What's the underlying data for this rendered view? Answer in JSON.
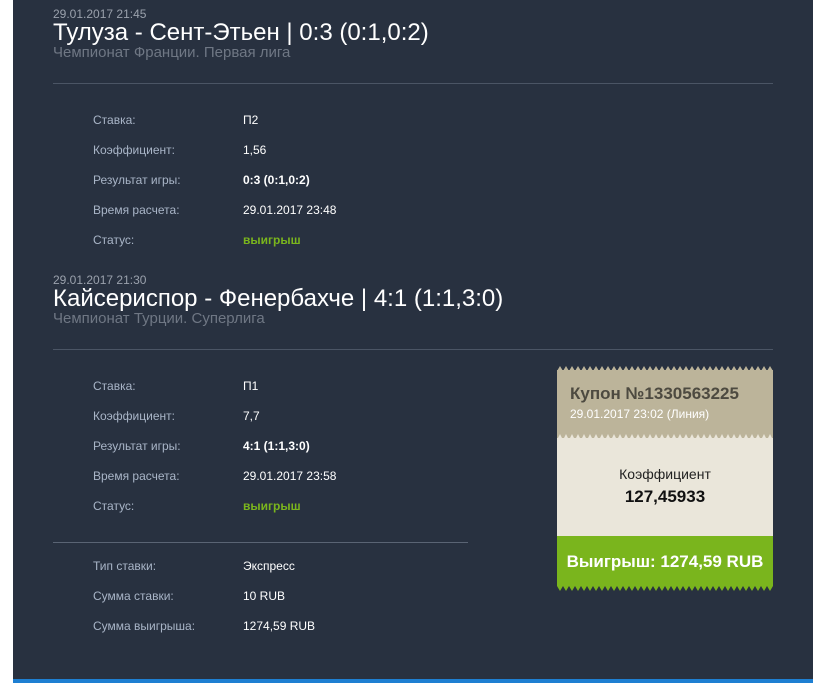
{
  "matches": [
    {
      "date": "29.01.2017 21:45",
      "title": "Тулуза - Сент-Этьен  |  0:3 (0:1,0:2)",
      "league": "Чемпионат Франции. Первая лига",
      "details": {
        "bet_label": "Ставка:",
        "bet_value": "П2",
        "coef_label": "Коэффициент:",
        "coef_value": "1,56",
        "result_label": "Результат игры:",
        "result_value": "0:3 (0:1,0:2)",
        "calc_label": "Время расчета:",
        "calc_value": "29.01.2017 23:48",
        "status_label": "Статус:",
        "status_value": "выигрыш"
      }
    },
    {
      "date": "29.01.2017 21:30",
      "title": "Кайсериспор - Фенербахче  |  4:1 (1:1,3:0)",
      "league": "Чемпионат Турции. Суперлига",
      "details": {
        "bet_label": "Ставка:",
        "bet_value": "П1",
        "coef_label": "Коэффициент:",
        "coef_value": "7,7",
        "result_label": "Результат игры:",
        "result_value": "4:1 (1:1,3:0)",
        "calc_label": "Время расчета:",
        "calc_value": "29.01.2017 23:58",
        "status_label": "Статус:",
        "status_value": "выигрыш"
      }
    }
  ],
  "summary": {
    "type_label": "Тип ставки:",
    "type_value": "Экспресс",
    "stake_label": "Сумма ставки:",
    "stake_value": "10 RUB",
    "payout_label": "Сумма выигрыша:",
    "payout_value": "1274,59 RUB"
  },
  "coupon": {
    "number": "Купон №1330563225",
    "date": "29.01.2017 23:02 (Линия)",
    "coef_label": "Коэффициент",
    "coef_value": "127,45933",
    "win": "Выигрыш: 1274,59 RUB"
  },
  "colors": {
    "panel_bg": "#283140",
    "win_green": "#7ab51d",
    "coupon_head": "#bcb49a",
    "coupon_body": "#eae6da",
    "accent_blue": "#1e7fd2"
  }
}
